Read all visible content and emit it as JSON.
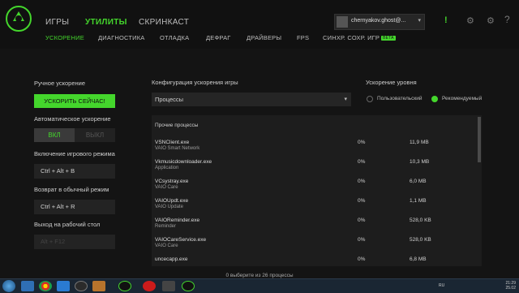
{
  "nav": {
    "primary": [
      {
        "label": "ИГРЫ",
        "active": false
      },
      {
        "label": "УТИЛИТЫ",
        "active": true
      },
      {
        "label": "СКРИНКАСТ",
        "active": false
      }
    ],
    "secondary": [
      {
        "label": "УСКОРЕНИЕ",
        "active": true
      },
      {
        "label": "ДИАГНОСТИКА",
        "active": false
      },
      {
        "label": "ОТЛАДКА",
        "active": false
      },
      {
        "label": "ДЕФРАГ",
        "active": false
      },
      {
        "label": "ДРАЙВЕРЫ",
        "active": false
      },
      {
        "label": "FPS",
        "active": false
      },
      {
        "label": "СИНХР. СОХР. ИГР",
        "active": false,
        "badge": "BETA"
      }
    ]
  },
  "account": {
    "name": "chernyakov.ghost@..."
  },
  "top_icons": [
    "alert-icon",
    "settings-icon"
  ],
  "left": {
    "manual_label": "Ручное ускорение",
    "boost_button": "УСКОРИТЬ СЕЙЧАС!",
    "auto_label": "Автоматическое ускорение",
    "toggle_on": "ВКЛ",
    "toggle_off": "ВЫКЛ",
    "game_mode_label": "Включение игрового режима",
    "game_mode_keys": "Ctrl + Alt + B",
    "normal_mode_label": "Возврат в обычный режим",
    "normal_mode_keys": "Ctrl + Alt + R",
    "desktop_label": "Выход на рабочий стол",
    "desktop_keys": "Alt + F12"
  },
  "config": {
    "label": "Конфигурация ускорения игры",
    "select_value": "Процессы",
    "level_label": "Ускорение уровня",
    "option_user": "Пользовательский",
    "option_recommended": "Рекомендуемый",
    "selected_option": "Рекомендуемый"
  },
  "table": {
    "header": "Прочие процессы",
    "rows": [
      {
        "name": "VSNClient.exe",
        "desc": "VAIO Smart Network",
        "cpu": "0%",
        "mem": "11,9 MB"
      },
      {
        "name": "Vkmusicdownloader.exe",
        "desc": "Application",
        "cpu": "0%",
        "mem": "10,3 MB"
      },
      {
        "name": "VCsystray.exe",
        "desc": "VAIO Care",
        "cpu": "0%",
        "mem": "6,0 MB"
      },
      {
        "name": "VAIOUpdt.exe",
        "desc": "VAIO Update",
        "cpu": "0%",
        "mem": "1,1 MB"
      },
      {
        "name": "VAIOReminder.exe",
        "desc": "Reminder",
        "cpu": "0%",
        "mem": "528,0 KB"
      },
      {
        "name": "VAIOCareService.exe",
        "desc": "VAIO Care",
        "cpu": "0%",
        "mem": "528,0 KB"
      },
      {
        "name": "uncecapp.exe",
        "desc": "",
        "cpu": "0%",
        "mem": "6,8 MB"
      }
    ]
  },
  "status": "0 выберите из 26 процессы",
  "taskbar": {
    "apps": [
      "ie-icon",
      "chrome-icon",
      "media-player-icon",
      "steam-icon",
      "counter-strike-icon",
      "razer-icon",
      "opera-icon",
      "app-icon",
      "razer-icon"
    ],
    "lang": "RU",
    "time": "21:29",
    "date": "25.02"
  },
  "colors": {
    "accent": "#44d62c",
    "background": "#141414"
  }
}
